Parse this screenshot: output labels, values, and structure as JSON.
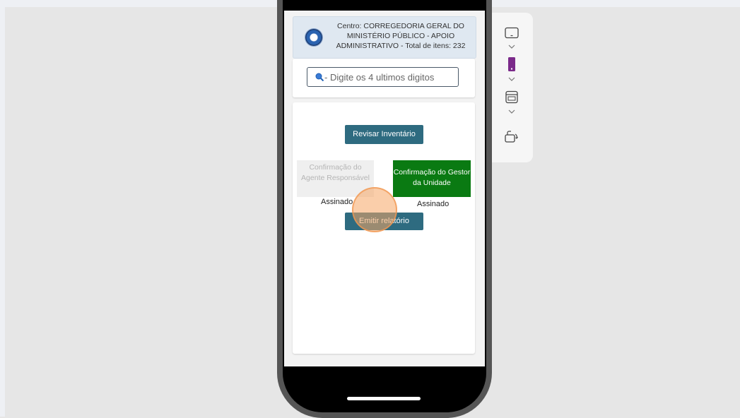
{
  "header": {
    "text": "Centro: CORREGEDORIA GERAL DO MINISTÉRIO PÚBLICO - APOIO ADMINISTRATIVO - Total de itens: 232",
    "logo_icon": "org-logo"
  },
  "search": {
    "placeholder": "- Digite os 4 ultimos digitos",
    "icon": "search-icon"
  },
  "actions": {
    "revisar_label": "Revisar Inventário",
    "emitir_label": "Emitir relatório"
  },
  "confirmations": {
    "agent_label": "Confirmação do Agente Responsável",
    "agent_status": "Assinado",
    "gestor_label": "Confirmação do Gestor da Unidade",
    "gestor_status": "Assinado"
  },
  "toolbar": {
    "items": [
      "tablet-icon",
      "phone-icon",
      "browser-window-icon",
      "rotate-icon"
    ]
  },
  "colors": {
    "primary_button": "#2e6b80",
    "confirmed_green": "#0a7a12",
    "disabled_gray": "#efefef",
    "header_bg": "#dfe8f1",
    "phone_accent": "#7b2a8a"
  }
}
